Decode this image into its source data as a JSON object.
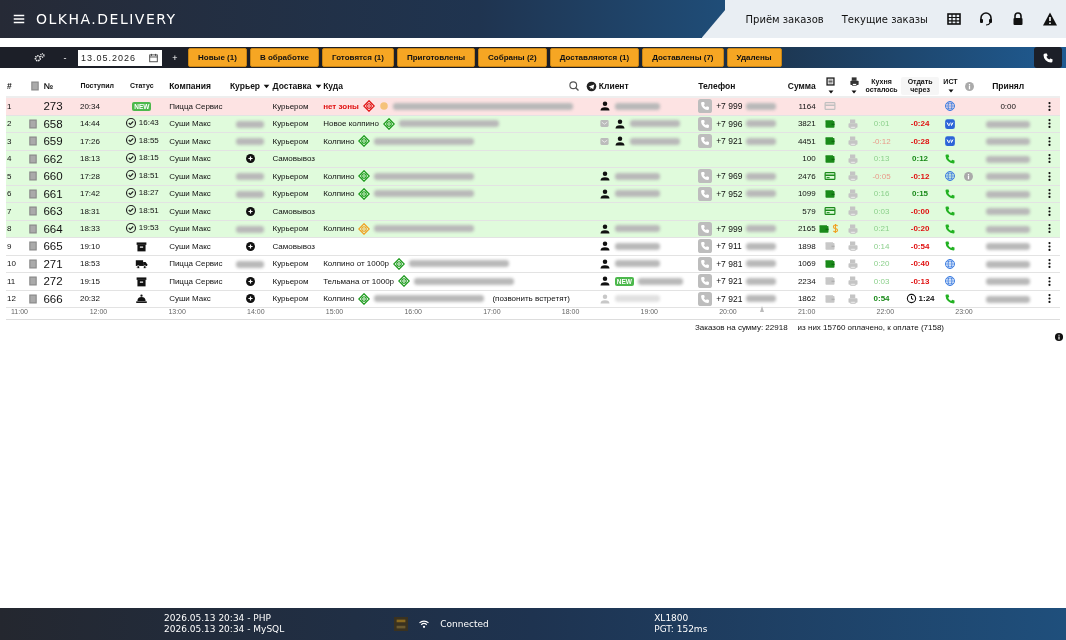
{
  "header": {
    "logo": "OLKHA.DELIVERY",
    "nav": [
      "Приём заказов",
      "Текущие заказы"
    ]
  },
  "toolbar": {
    "minus": "-",
    "date": "13.05.2026",
    "plus": "+",
    "filters": [
      "Новые (1)",
      "В обработке",
      "Готовятся (1)",
      "Приготовлены",
      "Собраны (2)",
      "Доставляются (1)",
      "Доставлены (7)",
      "Удалены"
    ]
  },
  "table": {
    "columns": {
      "num": "#",
      "id": "№",
      "received": "Поступил",
      "status": "Статус",
      "company": "Компания",
      "courier": "Курьер",
      "delivery": "Доставка",
      "address": "Куда",
      "client": "Клиент",
      "phone": "Телефон",
      "sum": "Сумма",
      "kitchen": "Кухня осталось",
      "give": "Отдать через",
      "source": "ИСТ",
      "accepted": "Принял"
    },
    "rows": [
      {
        "color": "#fde3e3",
        "n": "1",
        "doc": false,
        "id": "273",
        "received": "20:34",
        "status": {
          "kind": "new",
          "text": "NEW"
        },
        "company": "Пицца Сервис",
        "delivery": "Курьером",
        "zone": {
          "text": "нет зоны",
          "kind": "none"
        },
        "warn": true,
        "address": true,
        "client": {
          "icons": [
            {
              "kind": "person"
            }
          ]
        },
        "phone": "+7 999",
        "sum": "1164",
        "pay": {
          "kind": "card",
          "paid": false
        },
        "printer": false,
        "source": {
          "kind": "web"
        },
        "accepted": "0:00"
      },
      {
        "color": "#e0fbdc",
        "n": "2",
        "doc": true,
        "id": "658",
        "received": "14:44",
        "status": {
          "kind": "done",
          "time": "16:43"
        },
        "company": "Суши Макс",
        "courier": {
          "kind": "hidden"
        },
        "delivery": "Курьером",
        "zone": {
          "text": "Новое колпино",
          "kind": "ok"
        },
        "address": true,
        "client": {
          "icons": [
            {
              "kind": "mail"
            },
            {
              "kind": "person"
            }
          ]
        },
        "phone": "+7 996",
        "sum": "3821",
        "pay": {
          "kind": "cash",
          "paid": true
        },
        "printer": true,
        "kitchen": {
          "text": "0:01",
          "kind": "ok"
        },
        "give": {
          "text": "-0:24",
          "kind": "late"
        },
        "source": {
          "kind": "vk"
        }
      },
      {
        "color": "#e0fbdc",
        "n": "3",
        "doc": true,
        "id": "659",
        "received": "17:26",
        "status": {
          "kind": "done",
          "time": "18:55"
        },
        "company": "Суши Макс",
        "courier": {
          "kind": "hidden"
        },
        "delivery": "Курьером",
        "zone": {
          "text": "Колпино",
          "kind": "ok"
        },
        "address": true,
        "client": {
          "icons": [
            {
              "kind": "mail"
            },
            {
              "kind": "person"
            }
          ]
        },
        "phone": "+7 921",
        "sum": "4451",
        "pay": {
          "kind": "cash",
          "paid": true
        },
        "printer": true,
        "kitchen": {
          "text": "-0:12",
          "kind": "late"
        },
        "give": {
          "text": "-0:28",
          "kind": "late"
        },
        "source": {
          "kind": "vk"
        }
      },
      {
        "color": "#e0fbdc",
        "n": "4",
        "doc": true,
        "id": "662",
        "received": "18:13",
        "status": {
          "kind": "done",
          "time": "18:15"
        },
        "company": "Суши Макс",
        "courier": {
          "kind": "self"
        },
        "delivery": "Самовывоз",
        "sum": "100",
        "pay": {
          "kind": "cash",
          "paid": true
        },
        "printer": true,
        "kitchen": {
          "text": "0:13",
          "kind": "ok"
        },
        "give": {
          "text": "0:12",
          "kind": "ok"
        },
        "source": {
          "kind": "phone"
        }
      },
      {
        "color": "#e0fbdc",
        "n": "5",
        "doc": true,
        "id": "660",
        "received": "17:28",
        "status": {
          "kind": "done",
          "time": "18:51"
        },
        "company": "Суши Макс",
        "courier": {
          "kind": "hidden"
        },
        "delivery": "Курьером",
        "zone": {
          "text": "Колпино",
          "kind": "ok"
        },
        "address": true,
        "client": {
          "icons": [
            {
              "kind": "person"
            }
          ]
        },
        "phone": "+7 969",
        "sum": "2476",
        "pay": {
          "kind": "card",
          "paid": true
        },
        "printer": true,
        "kitchen": {
          "text": "-0:05",
          "kind": "late"
        },
        "give": {
          "text": "-0:12",
          "kind": "late"
        },
        "source": {
          "kind": "web"
        },
        "info": true
      },
      {
        "color": "#e0fbdc",
        "n": "6",
        "doc": true,
        "id": "661",
        "received": "17:42",
        "status": {
          "kind": "done",
          "time": "18:27"
        },
        "company": "Суши Макс",
        "courier": {
          "kind": "hidden"
        },
        "delivery": "Курьером",
        "zone": {
          "text": "Колпино",
          "kind": "ok"
        },
        "address": true,
        "client": {
          "icons": [
            {
              "kind": "person"
            }
          ]
        },
        "phone": "+7 952",
        "sum": "1099",
        "pay": {
          "kind": "cash",
          "paid": true
        },
        "printer": true,
        "kitchen": {
          "text": "0:16",
          "kind": "ok"
        },
        "give": {
          "text": "0:15",
          "kind": "ok"
        },
        "source": {
          "kind": "phone"
        }
      },
      {
        "color": "#e0fbdc",
        "n": "7",
        "doc": true,
        "id": "663",
        "received": "18:31",
        "status": {
          "kind": "done",
          "time": "18:51"
        },
        "company": "Суши Макс",
        "courier": {
          "kind": "self"
        },
        "delivery": "Самовывоз",
        "sum": "579",
        "pay": {
          "kind": "card",
          "paid": true
        },
        "printer": true,
        "kitchen": {
          "text": "0:03",
          "kind": "ok"
        },
        "give": {
          "text": "-0:00",
          "kind": "late"
        },
        "source": {
          "kind": "phone"
        }
      },
      {
        "color": "#e0fbdc",
        "n": "8",
        "doc": true,
        "id": "664",
        "received": "18:33",
        "status": {
          "kind": "done",
          "time": "19:53"
        },
        "company": "Суши Макс",
        "courier": {
          "kind": "hidden"
        },
        "delivery": "Курьером",
        "zone": {
          "text": "Колпино",
          "kind": "warn"
        },
        "address": true,
        "client": {
          "icons": [
            {
              "kind": "person"
            }
          ]
        },
        "phone": "+7 999",
        "sum": "2165",
        "pay": {
          "kind": "cash",
          "paid": true
        },
        "dollar": true,
        "printer": true,
        "kitchen": {
          "text": "0:21",
          "kind": "ok"
        },
        "give": {
          "text": "-0:20",
          "kind": "late"
        },
        "source": {
          "kind": "phone"
        }
      },
      {
        "color": "#ffffff",
        "n": "9",
        "doc": true,
        "id": "665",
        "received": "19:10",
        "status": {
          "kind": "box"
        },
        "company": "Суши Макс",
        "courier": {
          "kind": "self"
        },
        "delivery": "Самовывоз",
        "client": {
          "icons": [
            {
              "kind": "person"
            }
          ]
        },
        "phone": "+7 911",
        "sum": "1898",
        "pay": {
          "kind": "cash",
          "paid": false
        },
        "printer": true,
        "kitchen": {
          "text": "0:14",
          "kind": "ok"
        },
        "give": {
          "text": "-0:54",
          "kind": "late"
        },
        "source": {
          "kind": "phone"
        }
      },
      {
        "color": "#ffffff",
        "n": "10",
        "doc": true,
        "id": "271",
        "received": "18:53",
        "status": {
          "kind": "truck"
        },
        "company": "Пицца Сервис",
        "courier": {
          "kind": "hidden"
        },
        "delivery": "Курьером",
        "zone": {
          "text": "Колпино от 1000р",
          "kind": "ok"
        },
        "address": true,
        "client": {
          "icons": [
            {
              "kind": "person"
            }
          ]
        },
        "phone": "+7 981",
        "sum": "1069",
        "pay": {
          "kind": "cash",
          "paid": true
        },
        "printer": true,
        "kitchen": {
          "text": "0:20",
          "kind": "ok"
        },
        "give": {
          "text": "-0:40",
          "kind": "late"
        },
        "source": {
          "kind": "web"
        }
      },
      {
        "color": "#ffffff",
        "n": "11",
        "doc": true,
        "id": "272",
        "received": "19:15",
        "status": {
          "kind": "box"
        },
        "company": "Пицца Сервис",
        "courier": {
          "kind": "self"
        },
        "delivery": "Курьером",
        "zone": {
          "text": "Тельмана от 1000р",
          "kind": "ok"
        },
        "address": true,
        "client": {
          "icons": [
            {
              "kind": "person"
            }
          ],
          "badge": "NEW"
        },
        "phone": "+7 921",
        "sum": "2234",
        "pay": {
          "kind": "cash",
          "paid": false
        },
        "printer": true,
        "kitchen": {
          "text": "0:03",
          "kind": "ok"
        },
        "give": {
          "text": "-0:13",
          "kind": "late"
        },
        "source": {
          "kind": "web"
        }
      },
      {
        "color": "#ffffff",
        "n": "12",
        "doc": true,
        "id": "666",
        "received": "20:32",
        "status": {
          "kind": "cook"
        },
        "company": "Суши Макс",
        "courier": {
          "kind": "self"
        },
        "delivery": "Курьером",
        "zone": {
          "text": "Колпино",
          "kind": "ok"
        },
        "address": true,
        "note": "(позвонить встретят)",
        "client": {
          "icons": [
            {
              "kind": "person"
            }
          ],
          "muted": true
        },
        "phone": "+7 921",
        "sum": "1862",
        "pay": {
          "kind": "cash",
          "paid": false
        },
        "printer": true,
        "kitchen": {
          "text": "0:54",
          "kind": "now"
        },
        "give": {
          "text": "1:24",
          "kind": "timer"
        },
        "source": {
          "kind": "phone"
        }
      }
    ]
  },
  "timeline": [
    "11:00",
    "12:00",
    "13:00",
    "14:00",
    "15:00",
    "16:00",
    "17:00",
    "18:00",
    "19:00",
    "20:00",
    "21:00",
    "22:00",
    "23:00"
  ],
  "summary": {
    "total": "Заказов на сумму: 22918",
    "paid": "из них 15760 оплачено, к оплате (7158)"
  },
  "footer": {
    "php": "2026.05.13 20:34 - PHP",
    "mysql": "2026.05.13 20:34 - MySQL",
    "connection": "Connected",
    "server": "XL1800",
    "ping": "PGT: 152ms"
  }
}
